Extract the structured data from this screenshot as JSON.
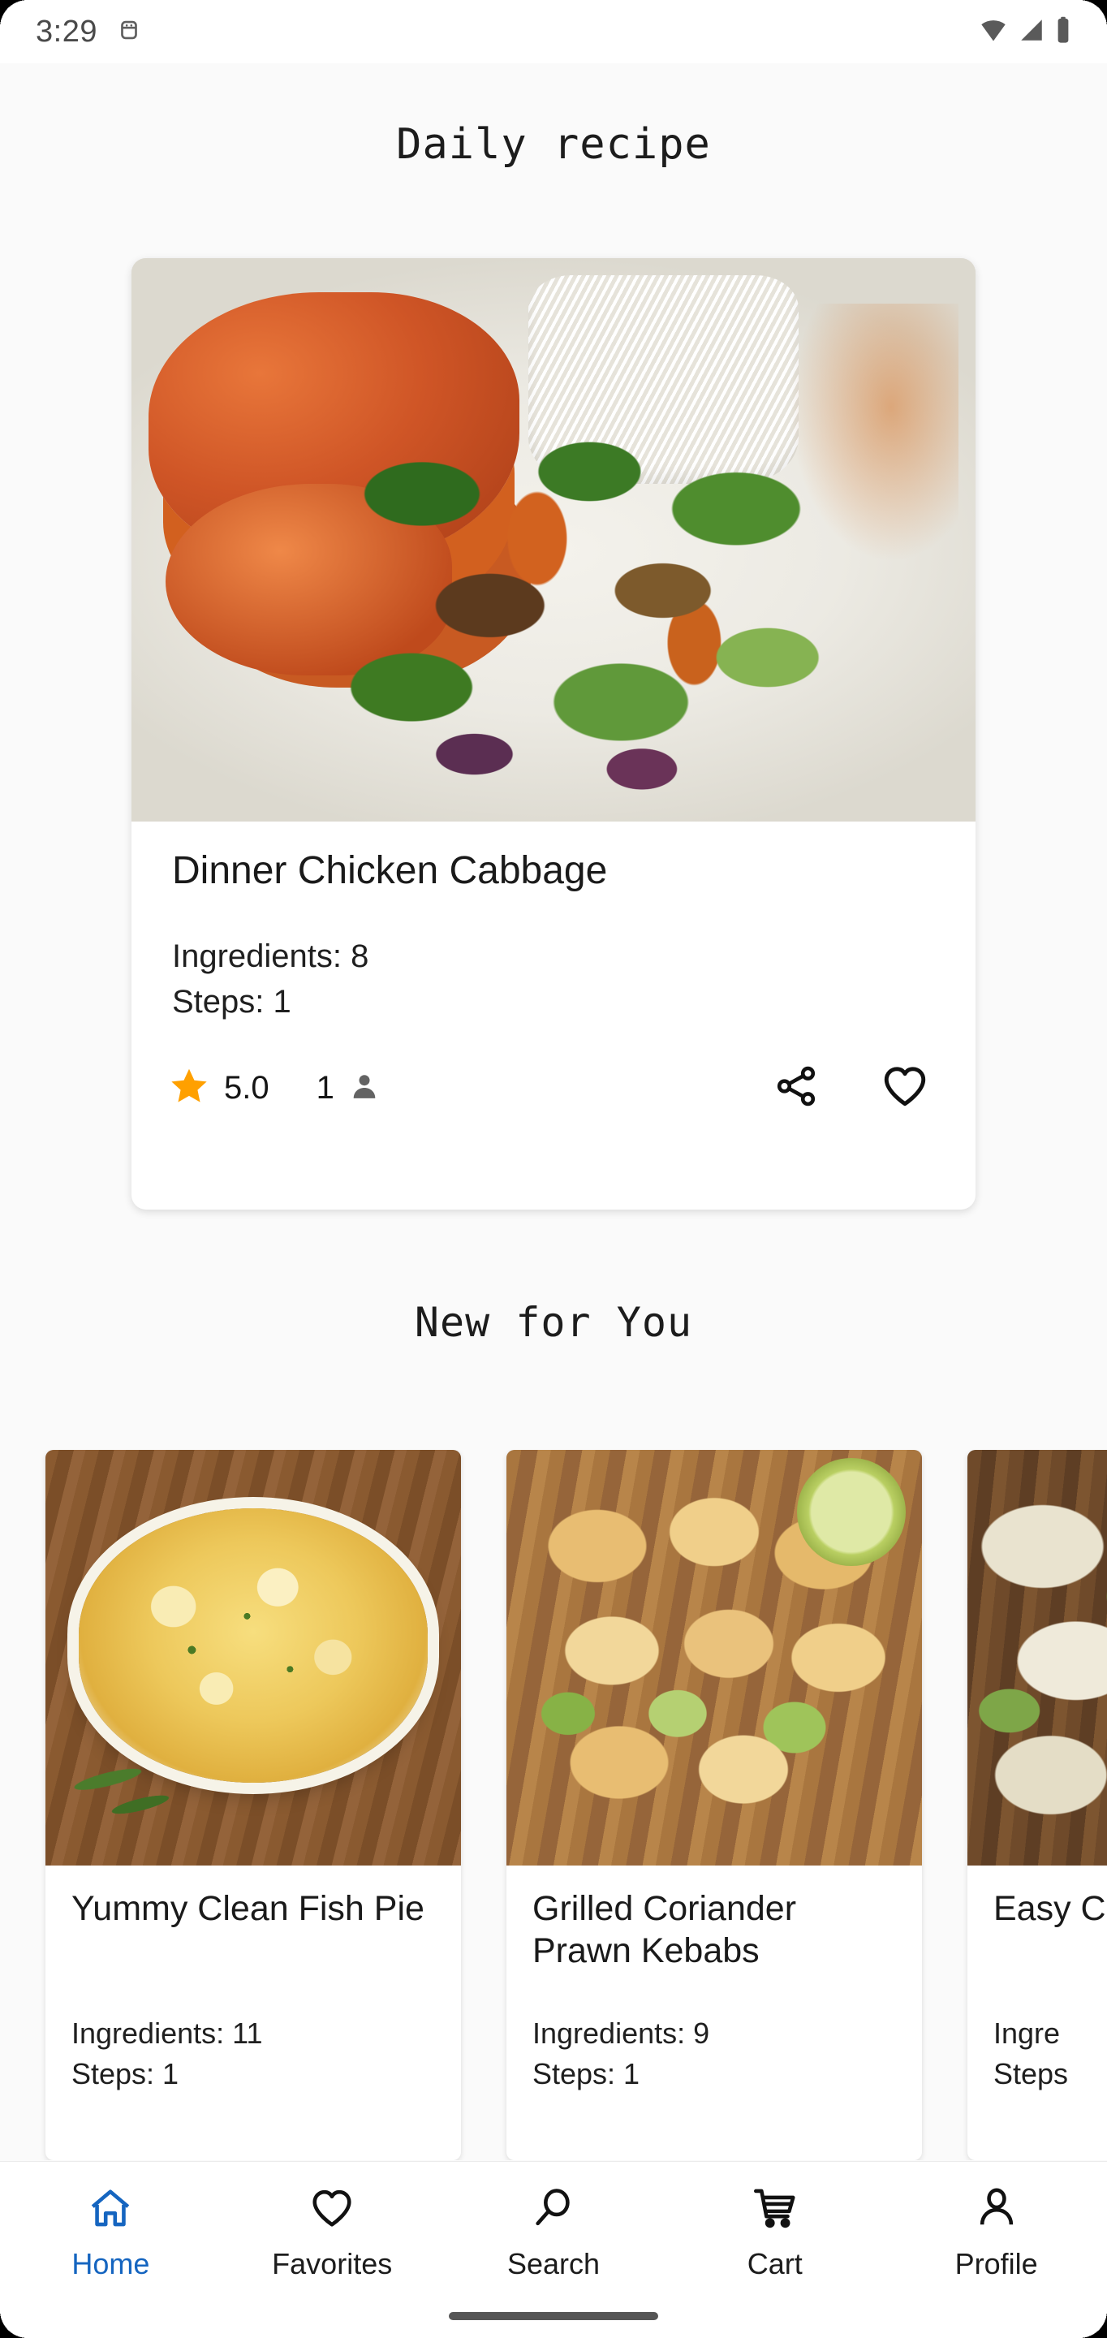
{
  "status_bar": {
    "time": "3:29",
    "icons": [
      "android-debug-icon",
      "wifi-icon",
      "cellular-signal-icon",
      "battery-icon"
    ]
  },
  "header": {
    "title": "Daily recipe"
  },
  "daily_recipe": {
    "title": "Dinner Chicken Cabbage",
    "ingredients_label": "Ingredients: 8",
    "steps_label": "Steps: 1",
    "rating": "5.0",
    "review_count": "1",
    "star_color": "#FFA000",
    "actions": [
      "share-icon",
      "favorite-heart-icon"
    ],
    "image_alt": "plate of chicken in tomato sauce with rice and mixed vegetables"
  },
  "new_for_you": {
    "section_title": "New for You",
    "cards": [
      {
        "title": "Yummy Clean Fish Pie",
        "ingredients_label": "Ingredients: 11",
        "steps_label": "Steps: 1",
        "image_alt": "golden baked fish pie in oval dish on wooden board"
      },
      {
        "title": "Grilled Coriander Prawn Kebabs",
        "ingredients_label": "Ingredients: 9",
        "steps_label": "Steps: 1",
        "image_alt": "grilled prawn kebabs with lime on wooden board"
      },
      {
        "title": "Easy Chick",
        "ingredients_label": "Ingre",
        "steps_label": "Steps",
        "image_alt": "chicken dish partially visible at screen edge"
      }
    ]
  },
  "bottom_nav": {
    "active_color": "#1565C0",
    "items": [
      {
        "label": "Home",
        "icon": "home-icon",
        "active": true
      },
      {
        "label": "Favorites",
        "icon": "heart-icon",
        "active": false
      },
      {
        "label": "Search",
        "icon": "search-icon",
        "active": false
      },
      {
        "label": "Cart",
        "icon": "cart-icon",
        "active": false
      },
      {
        "label": "Profile",
        "icon": "person-icon",
        "active": false
      }
    ]
  }
}
